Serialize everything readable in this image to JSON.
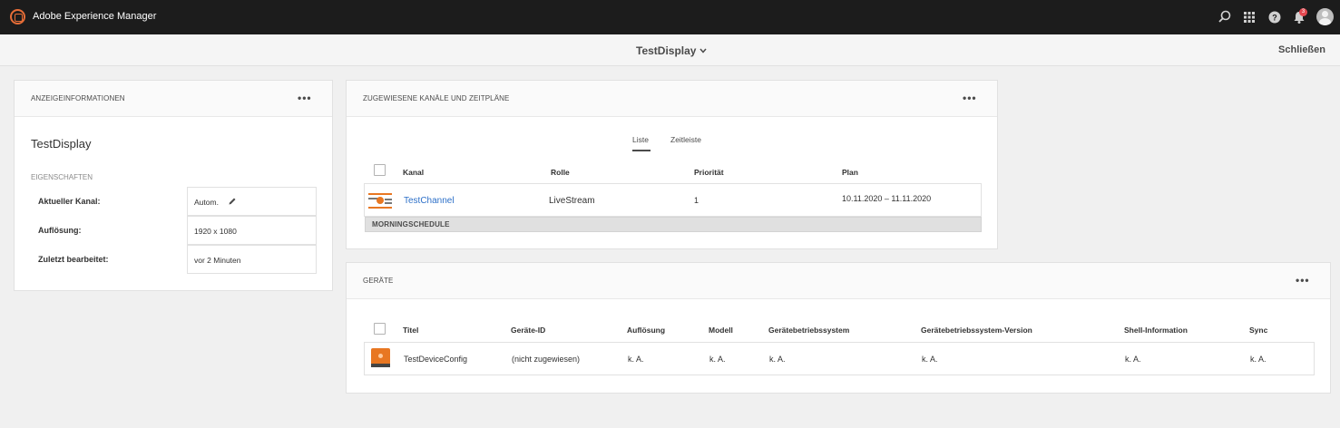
{
  "app": {
    "title": "Adobe Experience Manager",
    "notification_count": "3"
  },
  "header": {
    "title": "TestDisplay",
    "close_label": "Schließen"
  },
  "display_info": {
    "section_title": "ANZEIGEINFORMATIONEN",
    "name": "TestDisplay",
    "properties_label": "EIGENSCHAFTEN",
    "rows": [
      {
        "label": "Aktueller Kanal:",
        "value": "Autom."
      },
      {
        "label": "Auflösung:",
        "value": "1920 x 1080"
      },
      {
        "label": "Zuletzt bearbeitet:",
        "value": "vor 2 Minuten"
      }
    ]
  },
  "channels": {
    "section_title": "ZUGEWIESENE KANÄLE UND ZEITPLÄNE",
    "tabs": [
      "Liste",
      "Zeitleiste"
    ],
    "active_tab": "Liste",
    "columns": [
      "Kanal",
      "Rolle",
      "Priorität",
      "Plan"
    ],
    "rows": [
      {
        "channel": "TestChannel",
        "role": "LiveStream",
        "priority": "1",
        "plan": "10.11.2020 – 11.11.2020"
      }
    ],
    "schedule_label": "MORNINGSCHEDULE"
  },
  "devices": {
    "section_title": "GERÄTE",
    "columns": [
      "Titel",
      "Geräte-ID",
      "Auflösung",
      "Modell",
      "Gerätebetriebssystem",
      "Gerätebetriebssystem-Version",
      "Shell-Information",
      "Sync"
    ],
    "rows": [
      {
        "title": "TestDeviceConfig",
        "device_id": "(nicht zugewiesen)",
        "resolution": "k. A.",
        "model": "k. A.",
        "os": "k. A.",
        "os_version": "k. A.",
        "shell_info": "k. A.",
        "sync": "k. A."
      }
    ]
  },
  "colors": {
    "topbar": "#1c1c1c",
    "accent": "#e66d37",
    "link": "#2d70c8",
    "badge": "#e34850"
  },
  "icons": [
    "aem-logo-icon",
    "search-icon",
    "apps-grid-icon",
    "help-icon",
    "bell-icon",
    "avatar",
    "chevron-down-icon",
    "more-icon",
    "pencil-icon",
    "channel-thumbnail-icon",
    "device-thumbnail-icon"
  ]
}
